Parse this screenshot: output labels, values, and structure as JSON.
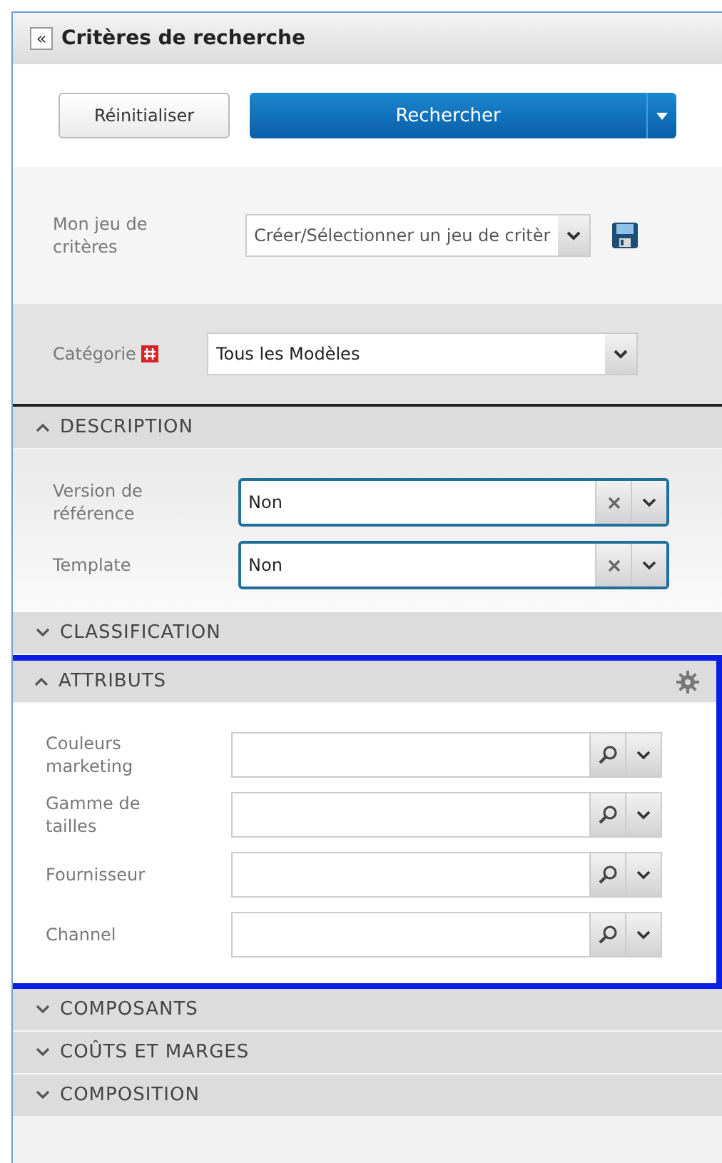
{
  "panel": {
    "title": "Critères de recherche",
    "collapse_icon": "«"
  },
  "buttons": {
    "reset": "Réinitialiser",
    "search": "Rechercher"
  },
  "criteria_set": {
    "label": "Mon jeu de critères",
    "value": "Créer/Sélectionner un jeu de critèr"
  },
  "category": {
    "label": "Catégorie",
    "required": true,
    "value": "Tous les Modèles"
  },
  "sections": [
    {
      "title": "DESCRIPTION",
      "expanded": true,
      "highlighted": false,
      "settings": false,
      "fields": [
        {
          "kind": "clearable",
          "label": "Version de référence",
          "value": "Non",
          "focused": true
        },
        {
          "kind": "clearable",
          "label": "Template",
          "value": "Non",
          "focused": true
        }
      ]
    },
    {
      "title": "CLASSIFICATION",
      "expanded": false,
      "highlighted": false,
      "settings": false
    },
    {
      "title": "ATTRIBUTS",
      "expanded": true,
      "highlighted": true,
      "settings": true,
      "fields": [
        {
          "kind": "lookup",
          "label": "Couleurs marketing",
          "focused": false
        },
        {
          "kind": "lookup",
          "label": "Gamme de tailles",
          "focused": false
        },
        {
          "kind": "lookup",
          "label": "Fournisseur",
          "focused": false
        },
        {
          "kind": "lookup",
          "label": "Channel",
          "focused": false
        }
      ]
    },
    {
      "title": "COMPOSANTS",
      "expanded": false,
      "highlighted": false,
      "settings": false
    },
    {
      "title": "COÛTS ET MARGES",
      "expanded": false,
      "highlighted": false,
      "settings": false
    },
    {
      "title": "COMPOSITION",
      "expanded": false,
      "highlighted": false,
      "settings": false
    }
  ]
}
